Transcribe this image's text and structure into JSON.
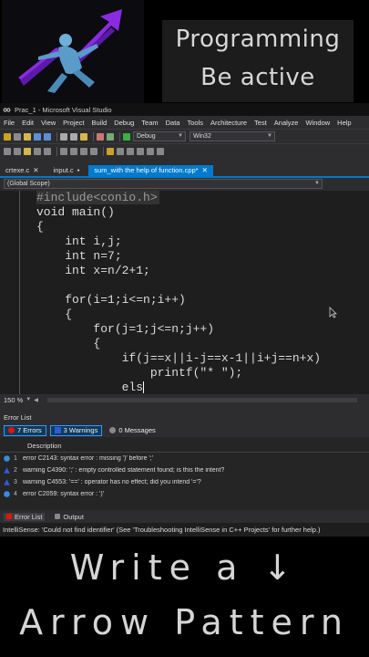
{
  "promo": {
    "line1": "Programming",
    "line2": "Be active"
  },
  "window": {
    "title": "Prac_1 - Microsoft Visual Studio"
  },
  "menu": [
    "File",
    "Edit",
    "View",
    "Project",
    "Build",
    "Debug",
    "Team",
    "Data",
    "Tools",
    "Architecture",
    "Test",
    "Analyze",
    "Window",
    "Help"
  ],
  "toolbar": {
    "config": "Debug",
    "platform": "Win32"
  },
  "tabs": [
    {
      "label": "crtexe.c",
      "active": false
    },
    {
      "label": "input.c",
      "active": false
    },
    {
      "label": "sum_with the help of function.cpp*",
      "active": true
    }
  ],
  "scope": "(Global Scope)",
  "code": [
    "#include<conio.h>",
    "void main()",
    "{",
    "    int i,j;",
    "    int n=7;",
    "    int x=n/2+1;",
    "",
    "    for(i=1;i<=n;i++)",
    "    {",
    "        for(j=1;j<=n;j++)",
    "        {",
    "            if(j==x||i-j==x-1||i+j==n+x)",
    "                printf(\"* \");",
    "            els"
  ],
  "zoom": "150 %",
  "error_list": {
    "title": "Error List",
    "filters": {
      "errors": "7 Errors",
      "warnings": "3 Warnings",
      "messages": "0 Messages"
    },
    "column": "Description",
    "rows": [
      {
        "type": "error",
        "num": "1",
        "desc": "error C2143: syntax error : missing ')' before ';'"
      },
      {
        "type": "warning",
        "num": "2",
        "desc": "warning C4390: ';' : empty controlled statement found; is this the intent?"
      },
      {
        "type": "warning",
        "num": "3",
        "desc": "warning C4553: '==' : operator has no effect; did you intend '='?"
      },
      {
        "type": "error",
        "num": "4",
        "desc": "error C2059: syntax error : ')'"
      }
    ]
  },
  "bottom_tabs": [
    "Error List",
    "Output"
  ],
  "status": "IntelliSense: 'Could not find identifier' (See 'Troubleshooting IntelliSense in C++ Projects' for further help.)",
  "caption": {
    "line1": "Write a ↓",
    "line2": "Arrow Pattern"
  },
  "colors": {
    "accent": "#007acc",
    "error": "#e51400",
    "warning": "#2f5cd6",
    "editor_bg": "#1e1e1e",
    "promo_bg": "#1c1c1c"
  },
  "icons": {
    "logo": "dancing-figure-with-purple-rising-arrow"
  }
}
